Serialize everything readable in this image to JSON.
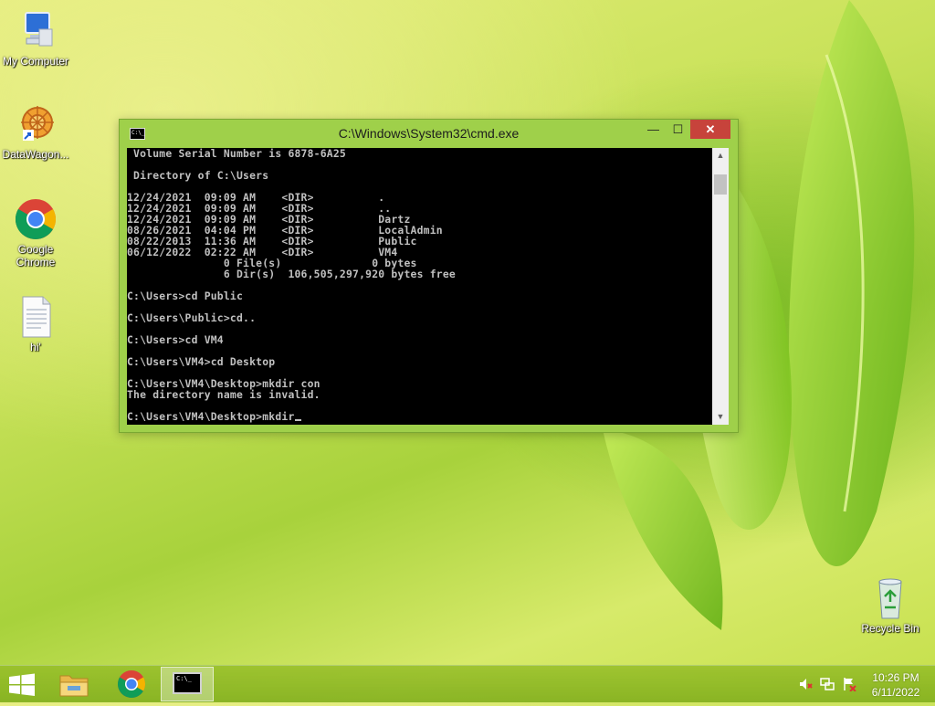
{
  "desktop": {
    "icons": [
      {
        "label": "My Computer",
        "icon": "computer-icon"
      },
      {
        "label": "DataWagon...",
        "icon": "datawagon-shortcut-icon"
      },
      {
        "label": "Google Chrome",
        "icon": "chrome-icon"
      },
      {
        "label": "hi'",
        "icon": "text-file-icon"
      },
      {
        "label": "Recycle Bin",
        "icon": "recycle-bin-icon"
      }
    ]
  },
  "cmd_window": {
    "title": "C:\\Windows\\System32\\cmd.exe",
    "app_icon_text": "C:\\_",
    "minimize": "—",
    "maximize": "☐",
    "close": "✕",
    "lines": [
      " Volume Serial Number is 6878-6A25",
      "",
      " Directory of C:\\Users",
      "",
      "12/24/2021  09:09 AM    <DIR>          .",
      "12/24/2021  09:09 AM    <DIR>          ..",
      "12/24/2021  09:09 AM    <DIR>          Dartz",
      "08/26/2021  04:04 PM    <DIR>          LocalAdmin",
      "08/22/2013  11:36 AM    <DIR>          Public",
      "06/12/2022  02:22 AM    <DIR>          VM4",
      "               0 File(s)              0 bytes",
      "               6 Dir(s)  106,505,297,920 bytes free",
      "",
      "C:\\Users>cd Public",
      "",
      "C:\\Users\\Public>cd..",
      "",
      "C:\\Users>cd VM4",
      "",
      "C:\\Users\\VM4>cd Desktop",
      "",
      "C:\\Users\\VM4\\Desktop>mkdir con",
      "The directory name is invalid.",
      "",
      "C:\\Users\\VM4\\Desktop>mkdir"
    ]
  },
  "taskbar": {
    "items": [
      {
        "name": "start-button",
        "icon": "windows-logo-icon"
      },
      {
        "name": "file-explorer",
        "icon": "folder-icon"
      },
      {
        "name": "google-chrome",
        "icon": "chrome-icon"
      },
      {
        "name": "command-prompt",
        "icon": "cmd-icon",
        "active": true
      }
    ],
    "tray_icons": [
      "speaker-muted-icon",
      "network-icon",
      "action-center-flag-icon"
    ],
    "time": "10:26 PM",
    "date": "6/11/2022"
  },
  "colors": {
    "window_frame": "#9fd04a",
    "close_button": "#c7433b",
    "console_bg": "#000000",
    "console_text": "#c0c0c0"
  }
}
